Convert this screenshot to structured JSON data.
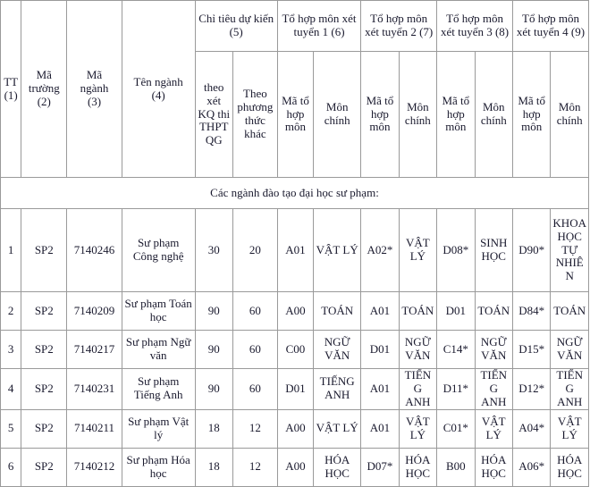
{
  "document": {
    "type": "admission-quota-table",
    "section_title": "Các ngành đào tạo đại học sư phạm:"
  },
  "header": {
    "tt": "TT (1)",
    "tt_line1": "TT",
    "tt_line2": "(1)",
    "ma_truong": "Mã trường (2)",
    "ma_truong_line1": "Mã",
    "ma_truong_line2": "trường",
    "ma_truong_line3": "(2)",
    "ma_nganh_line1": "Mã",
    "ma_nganh_line2": "ngành",
    "ma_nganh_line3": "(3)",
    "ten_nganh_line1": "Tên ngành",
    "ten_nganh_line2": "(4)",
    "chi_tieu": "Chỉ tiêu dự kiến (5)",
    "chi_tieu_sub1": "theo xét KQ thi THPT QG",
    "chi_tieu_sub2": "Theo phương thức khác",
    "to_hop_1": "Tổ hợp môn xét tuyển 1 (6)",
    "to_hop_2": "Tổ hợp môn xét tuyển 2 (7)",
    "to_hop_3": "Tổ hợp môn xét tuyển 3 (8)",
    "to_hop_4": "Tổ hợp môn xét tuyển 4 (9)",
    "ma_to_hop_mon": "Mã tổ hợp môn",
    "mon_chinh": "Môn chính"
  },
  "rows": [
    {
      "tt": "1",
      "ma_truong": "SP2",
      "ma_nganh": "7140246",
      "ten_nganh": "Sư phạm Công nghệ",
      "ct_thpt": "30",
      "ct_khac": "20",
      "ma1": "A01",
      "mon1": "VẬT LÝ",
      "ma2": "A02*",
      "mon2": "VẬT LÝ",
      "ma3": "D08*",
      "mon3": "SINH HỌC",
      "ma4": "D90*",
      "mon4": "KHOA HỌC TỰ NHIÊN"
    },
    {
      "tt": "2",
      "ma_truong": "SP2",
      "ma_nganh": "7140209",
      "ten_nganh": "Sư phạm Toán học",
      "ct_thpt": "90",
      "ct_khac": "60",
      "ma1": "A00",
      "mon1": "TOÁN",
      "ma2": "A01",
      "mon2": "TOÁN",
      "ma3": "D01",
      "mon3": "TOÁN",
      "ma4": "D84*",
      "mon4": "TOÁN"
    },
    {
      "tt": "3",
      "ma_truong": "SP2",
      "ma_nganh": "7140217",
      "ten_nganh": "Sư phạm Ngữ văn",
      "ct_thpt": "90",
      "ct_khac": "60",
      "ma1": "C00",
      "mon1": "NGỮ VĂN",
      "ma2": "D01",
      "mon2": "NGỮ VĂN",
      "ma3": "C14*",
      "mon3": "NGỮ VĂN",
      "ma4": "D15*",
      "mon4": "NGỮ VĂN"
    },
    {
      "tt": "4",
      "ma_truong": "SP2",
      "ma_nganh": "7140231",
      "ten_nganh": "Sư phạm Tiếng Anh",
      "ct_thpt": "90",
      "ct_khac": "60",
      "ma1": "D01",
      "mon1": "TIẾNG ANH",
      "ma2": "A01",
      "mon2": "TIẾNG ANH",
      "ma3": "D11*",
      "mon3": "TIẾNG ANH",
      "ma4": "D12*",
      "mon4": "TIẾNG ANH"
    },
    {
      "tt": "5",
      "ma_truong": "SP2",
      "ma_nganh": "7140211",
      "ten_nganh": "Sư phạm Vật lý",
      "ct_thpt": "18",
      "ct_khac": "12",
      "ma1": "A00",
      "mon1": "VẬT LÝ",
      "ma2": "A01",
      "mon2": "VẬT LÝ",
      "ma3": "C01*",
      "mon3": "VẬT LÝ",
      "ma4": "A04*",
      "mon4": "VẬT LÝ"
    },
    {
      "tt": "6",
      "ma_truong": "SP2",
      "ma_nganh": "7140212",
      "ten_nganh": "Sư phạm Hóa học",
      "ct_thpt": "18",
      "ct_khac": "12",
      "ma1": "A00",
      "mon1": "HÓA HỌC",
      "ma2": "D07*",
      "mon2": "HÓA HỌC",
      "ma3": "B00",
      "mon3": "HÓA HỌC",
      "ma4": "A06*",
      "mon4": "HÓA HỌC"
    }
  ],
  "colors": {
    "border": "#9a9a9a",
    "text": "#1a1a2e",
    "background": "#ffffff"
  }
}
